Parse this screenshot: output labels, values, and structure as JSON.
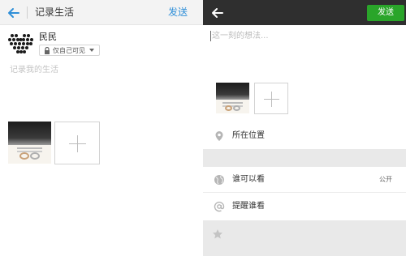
{
  "left": {
    "title": "记录生活",
    "send_label": "发送",
    "username": "民民",
    "privacy_label": "仅自己可见",
    "placeholder": "记录我的生活"
  },
  "right": {
    "send_label": "发送",
    "placeholder": "这一刻的想法...",
    "rows": {
      "location": "所在位置",
      "who_can_see": "谁可以看",
      "who_can_see_value": "公开",
      "remind": "提醒谁看"
    }
  },
  "colors": {
    "left_accent": "#2f8fd8",
    "right_header": "#2f2f2f",
    "send_green": "#2aa52a"
  }
}
